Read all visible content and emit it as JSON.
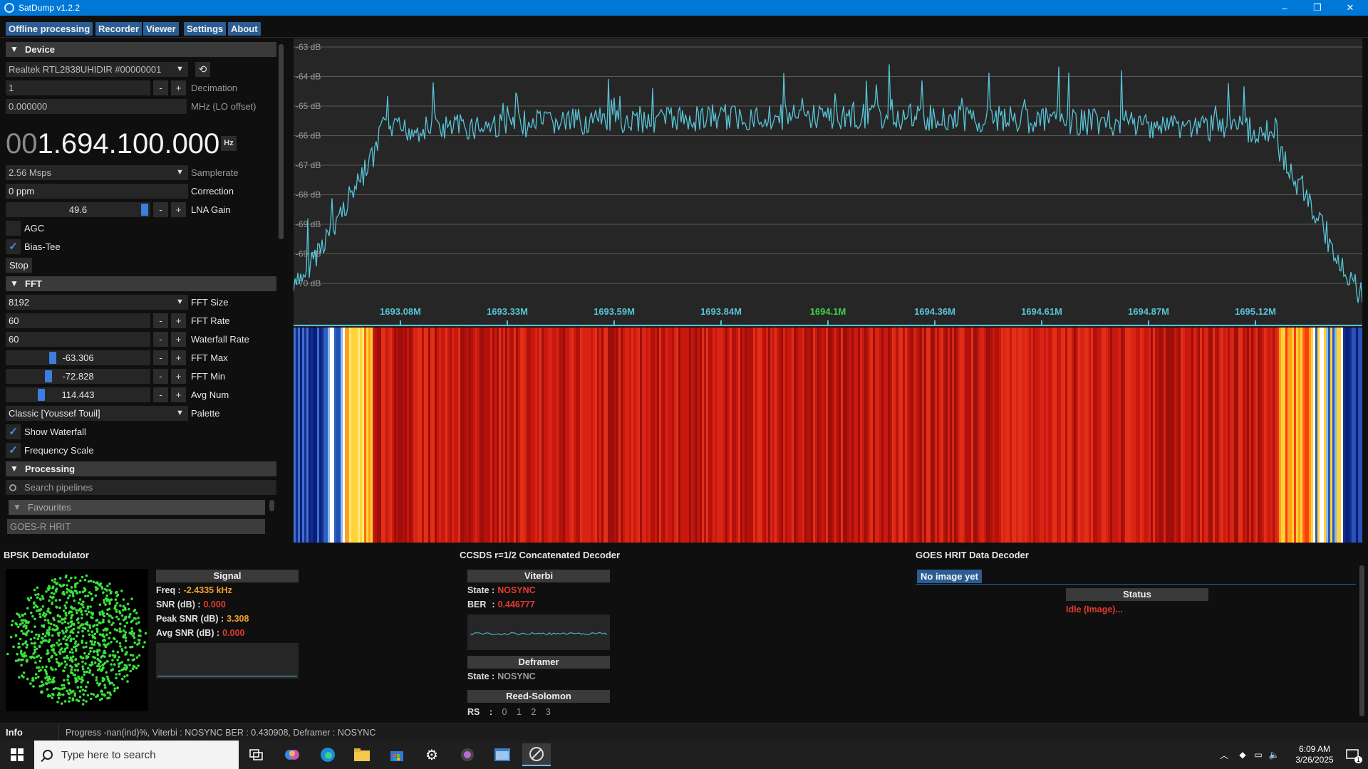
{
  "window": {
    "title": "SatDump v1.2.2",
    "controls": [
      "–",
      "❐",
      "✕"
    ]
  },
  "menu": {
    "tabs": [
      "Offline processing",
      "Recorder",
      "Viewer",
      "Settings",
      "About"
    ]
  },
  "device": {
    "section_label": "Device",
    "device_name": "Realtek RTL2838UHIDIR #00000001",
    "decimation_value": "1",
    "decimation_label": "Decimation",
    "lo_offset_value": "0.000000",
    "lo_offset_label": "MHz (LO offset)",
    "frequency_lead": "00",
    "frequency_main": "1.694.100.000",
    "frequency_unit": "Hz",
    "samplerate_value": "2.56 Msps",
    "samplerate_label": "Samplerate",
    "correction_value": "0 ppm",
    "correction_label": "Correction",
    "lna_gain_value": "49.6",
    "lna_gain_label": "LNA Gain",
    "lna_gain_fraction": 0.985,
    "agc_label": "AGC",
    "agc_checked": false,
    "bias_tee_label": "Bias-Tee",
    "bias_tee_checked": true,
    "stop_label": "Stop"
  },
  "fft": {
    "section_label": "FFT",
    "fft_size_value": "8192",
    "fft_size_label": "FFT Size",
    "fft_rate_value": "60",
    "fft_rate_label": "FFT Rate",
    "waterfall_rate_value": "60",
    "waterfall_rate_label": "Waterfall Rate",
    "fft_max_value": "-63.306",
    "fft_max_label": "FFT Max",
    "fft_min_value": "-72.828",
    "fft_min_label": "FFT Min",
    "avg_num_value": "114.443",
    "avg_num_label": "Avg Num",
    "palette_value": "Classic [Youssef Touil]",
    "palette_label": "Palette",
    "show_waterfall_label": "Show Waterfall",
    "frequency_scale_label": "Frequency Scale"
  },
  "processing": {
    "section_label": "Processing",
    "search_placeholder": "Search pipelines",
    "favourites_label": "Favourites",
    "first_pipeline": "GOES-R HRIT"
  },
  "spectrum": {
    "db_labels": [
      "-63 dB",
      "-64 dB",
      "-65 dB",
      "-66 dB",
      "-67 dB",
      "-68 dB",
      "-69 dB",
      "-69 dB",
      "-70 dB"
    ],
    "freq_labels": [
      "1693.08M",
      "1693.33M",
      "1693.59M",
      "1693.84M",
      "1694.1M",
      "1694.36M",
      "1694.61M",
      "1694.87M",
      "1695.12M"
    ],
    "center_label": "1694.1M",
    "line_color": "#57c3d6",
    "center_color": "#3fd24a"
  },
  "bpsk": {
    "title": "BPSK Demodulator",
    "signal_head": "Signal",
    "freq_key": "Freq :",
    "freq_val": "-2.4335 kHz",
    "snr_key": "SNR (dB) :",
    "snr_val": "0.000",
    "peak_snr_key": "Peak SNR (dB) :",
    "peak_snr_val": "3.308",
    "avg_snr_key": "Avg SNR (dB) :",
    "avg_snr_val": "0.000"
  },
  "ccsds": {
    "title": "CCSDS r=1/2 Concatenated Decoder",
    "viterbi_head": "Viterbi",
    "state_key": "State :",
    "viterbi_state": "NOSYNC",
    "ber_key": "BER",
    "ber_sep": ":",
    "ber_val": "0.446777",
    "deframer_head": "Deframer",
    "deframer_state_key": "State :",
    "deframer_state": "NOSYNC",
    "rs_head": "Reed-Solomon",
    "rs_key": "RS",
    "rs_sep": ":",
    "rs_values": [
      "0",
      "1",
      "2",
      "3"
    ]
  },
  "goes": {
    "title": "GOES HRIT Data Decoder",
    "no_image": "No image yet",
    "status_head": "Status",
    "status_val": "Idle (Image)..."
  },
  "infobar": {
    "label": "Info",
    "message": "Progress -nan(ind)%, Viterbi : NOSYNC BER : 0.430908, Deframer : NOSYNC"
  },
  "taskbar": {
    "search_placeholder": "Type here to search",
    "time": "6:09 AM",
    "date": "3/26/2025",
    "notification_count": "1"
  }
}
